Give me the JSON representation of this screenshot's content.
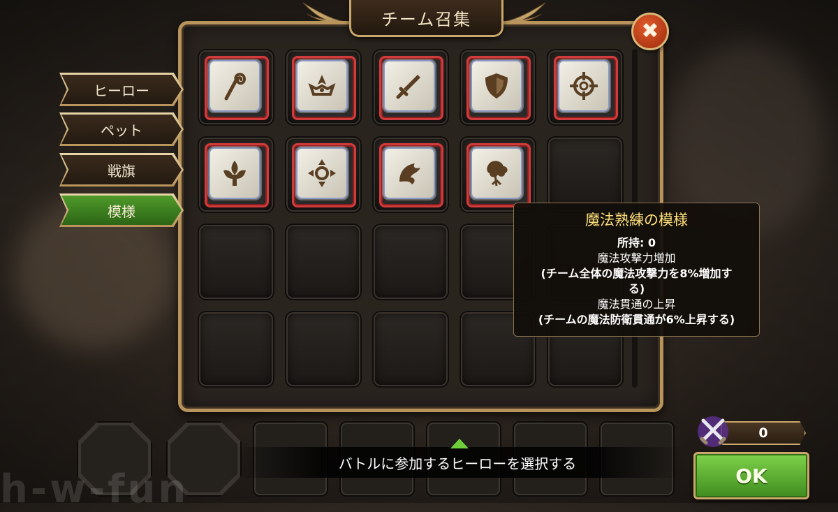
{
  "title": "チーム召集",
  "tabs": [
    {
      "label": "ヒーロー",
      "active": false
    },
    {
      "label": "ペット",
      "active": false
    },
    {
      "label": "戦旗",
      "active": false
    },
    {
      "label": "模様",
      "active": true
    }
  ],
  "close_icon": "close-x-icon",
  "grid": {
    "items": [
      {
        "icon": "magic-staff-pattern-icon"
      },
      {
        "icon": "crown-pattern-icon"
      },
      {
        "icon": "sword-pattern-icon"
      },
      {
        "icon": "shield-pattern-icon"
      },
      {
        "icon": "crosshair-pattern-icon"
      },
      {
        "icon": "fleur-pattern-icon"
      },
      {
        "icon": "arrows-pattern-icon"
      },
      {
        "icon": "dragon-pattern-icon"
      },
      {
        "icon": "tree-pattern-icon"
      }
    ]
  },
  "tooltip": {
    "title": "魔法熟練の模様",
    "owned": "所持: 0",
    "effect1_name": "魔法攻撃力増加",
    "effect1_desc_a": "(チーム全体の魔法攻撃力を8%増加す",
    "effect1_desc_b": "る)",
    "effect2_name": "魔法貫通の上昇",
    "effect2_desc": "(チームの魔法防衛貫通が6%上昇する)"
  },
  "hint": "バトルに参加するヒーローを選択する",
  "power": {
    "value": "0",
    "icon": "crossed-swords-icon"
  },
  "ok_label": "OK",
  "watermark": "h-w-fun",
  "colors": {
    "active_tab": "#3f8c1f",
    "item_border": "#d23b3b",
    "tooltip_title": "#ffe07a"
  }
}
